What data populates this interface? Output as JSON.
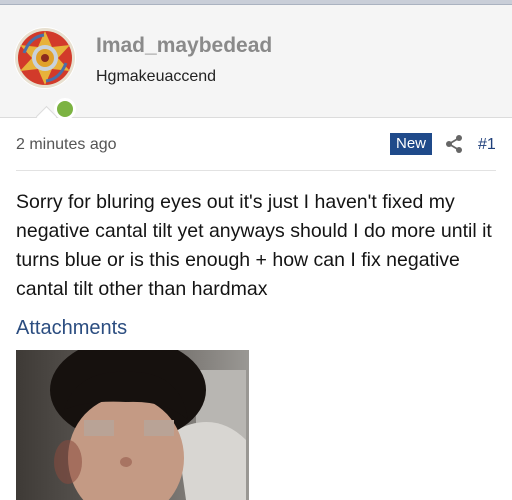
{
  "user": {
    "name": "Imad_maybedead",
    "title": "Hgmakeuaccend",
    "avatar_icon": "beyblade-avatar-icon",
    "online_color": "#7cb342"
  },
  "post": {
    "timestamp": "2 minutes ago",
    "badge": "New",
    "share_icon": "share-icon",
    "number": "#1",
    "message": "Sorry for bluring eyes out it's just I haven't fixed my negative cantal tilt yet anyways should I do more until it turns blue or is this enough + how can I fix negative cantal tilt other than hardmax",
    "attachments_heading": "Attachments"
  },
  "colors": {
    "badge_bg": "#1f4a8a",
    "link": "#2b4d80",
    "username": "#8a8a8a"
  }
}
